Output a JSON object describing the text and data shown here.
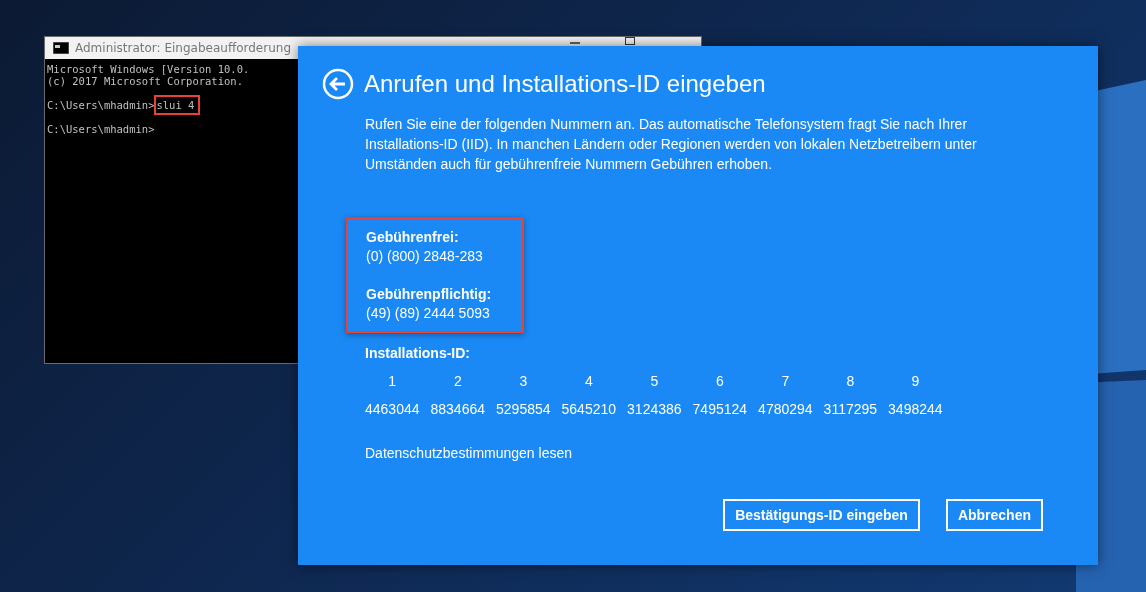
{
  "console_window": {
    "title": "Administrator: Eingabeaufforderung",
    "lines": [
      {
        "kind": "output",
        "text": "Microsoft Windows [Version 10.0."
      },
      {
        "kind": "output",
        "text": "(c) 2017 Microsoft Corporation."
      },
      {
        "kind": "blank"
      },
      {
        "kind": "input",
        "prompt": "C:\\Users\\mhadmin>",
        "command": "slui 4",
        "highlighted": true
      },
      {
        "kind": "blank"
      },
      {
        "kind": "input",
        "prompt": "C:\\Users\\mhadmin>"
      }
    ]
  },
  "dialog": {
    "title": "Anrufen und Installations-ID eingeben",
    "description": "Rufen Sie eine der folgenden Nummern an. Das automatische Telefonsystem fragt Sie nach Ihrer Installations-ID (IID). In manchen Ländern oder Regionen werden von lokalen Netzbetreibern unter Umständen auch für gebührenfreie Nummern Gebühren erhoben.",
    "phone_block_highlighted": true,
    "phone_numbers": [
      {
        "label": "Gebührenfrei:",
        "number": "(0) (800) 2848-283"
      },
      {
        "label": "Gebührenpflichtig:",
        "number": "(49) (89) 2444 5093"
      }
    ],
    "installation_id": {
      "label": "Installations-ID:",
      "groups": [
        {
          "index": "1",
          "value": "4463044"
        },
        {
          "index": "2",
          "value": "8834664"
        },
        {
          "index": "3",
          "value": "5295854"
        },
        {
          "index": "4",
          "value": "5645210"
        },
        {
          "index": "5",
          "value": "3124386"
        },
        {
          "index": "6",
          "value": "7495124"
        },
        {
          "index": "7",
          "value": "4780294"
        },
        {
          "index": "8",
          "value": "3117295"
        },
        {
          "index": "9",
          "value": "3498244"
        }
      ]
    },
    "privacy_link": "Datenschutzbestimmungen lesen",
    "buttons": [
      "Bestätigungs-ID eingeben",
      "Abbrechen"
    ]
  }
}
